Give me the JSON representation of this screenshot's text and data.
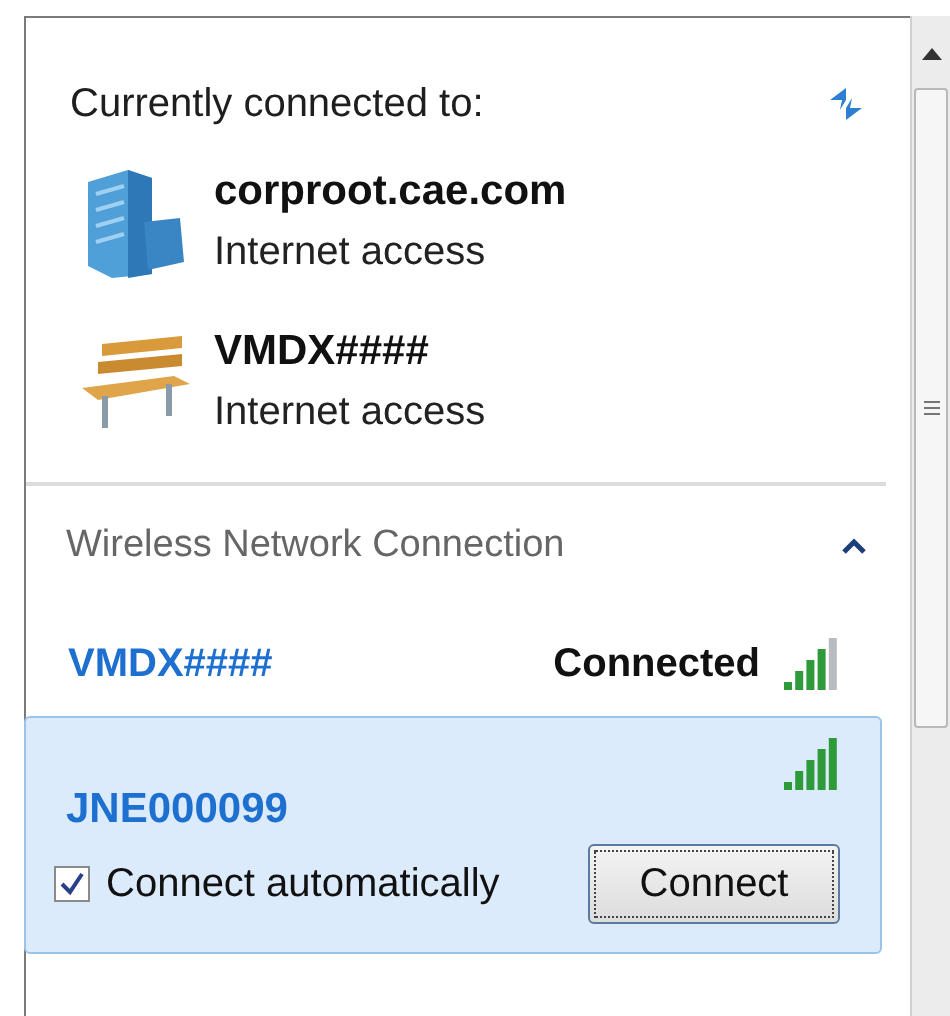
{
  "connected_header": "Currently connected to:",
  "connections": [
    {
      "kind": "domain",
      "name": "corproot.cae.com",
      "status": "Internet access"
    },
    {
      "kind": "public",
      "name": "VMDX####",
      "status": "Internet access"
    }
  ],
  "wireless": {
    "title": "Wireless Network Connection",
    "expanded": true,
    "networks": [
      {
        "name": "VMDX####",
        "status": "Connected",
        "level": 0.8,
        "selected": false
      },
      {
        "name": "JNE000099",
        "level": 1,
        "selected": true,
        "auto_label": "Connect automatically",
        "auto_checked": true,
        "button": "Connect"
      }
    ]
  }
}
